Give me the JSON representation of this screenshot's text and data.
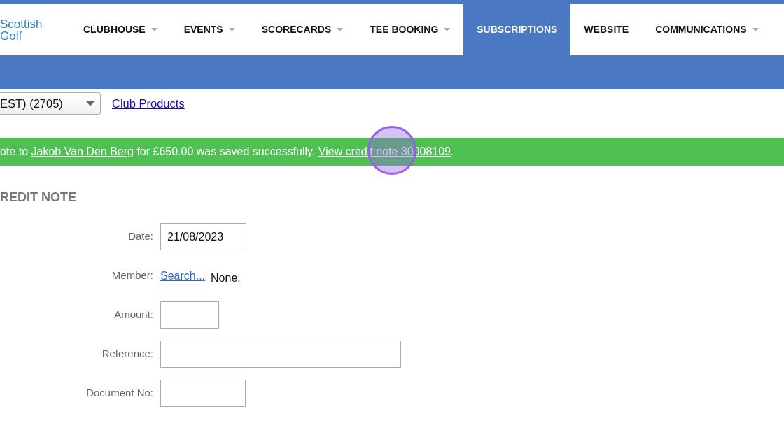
{
  "header": {
    "logo": [
      "Scottish",
      "Golf"
    ],
    "nav": [
      {
        "label": "CLUBHOUSE",
        "dropdown": true,
        "selected": false
      },
      {
        "label": "EVENTS",
        "dropdown": true,
        "selected": false
      },
      {
        "label": "SCORECARDS",
        "dropdown": true,
        "selected": false
      },
      {
        "label": "TEE BOOKING",
        "dropdown": true,
        "selected": false
      },
      {
        "label": "SUBSCRIPTIONS",
        "dropdown": false,
        "selected": true
      },
      {
        "label": "WEBSITE",
        "dropdown": false,
        "selected": false
      },
      {
        "label": "COMMUNICATIONS",
        "dropdown": true,
        "selected": false
      }
    ]
  },
  "toolbar": {
    "select_value": "EST) (2705)",
    "link": "Club Products"
  },
  "alert": {
    "segments": [
      {
        "kind": "text",
        "text": "ote to "
      },
      {
        "kind": "link",
        "text": "Jakob Van Den Berg"
      },
      {
        "kind": "text",
        "text": " for £650.00 was saved successfully. "
      },
      {
        "kind": "link",
        "text": "View credit note 30008109"
      },
      {
        "kind": "text",
        "text": "."
      }
    ]
  },
  "form": {
    "heading": "REDIT NOTE",
    "fields": [
      {
        "label": "Date:",
        "kind": "input",
        "value": "21/08/2023"
      },
      {
        "label": "Member:",
        "kind": "search",
        "link": "Search...",
        "value": "None."
      },
      {
        "label": "Amount:",
        "kind": "input"
      },
      {
        "label": "Reference:",
        "kind": "input"
      },
      {
        "label": "Document No:",
        "kind": "input"
      }
    ]
  }
}
